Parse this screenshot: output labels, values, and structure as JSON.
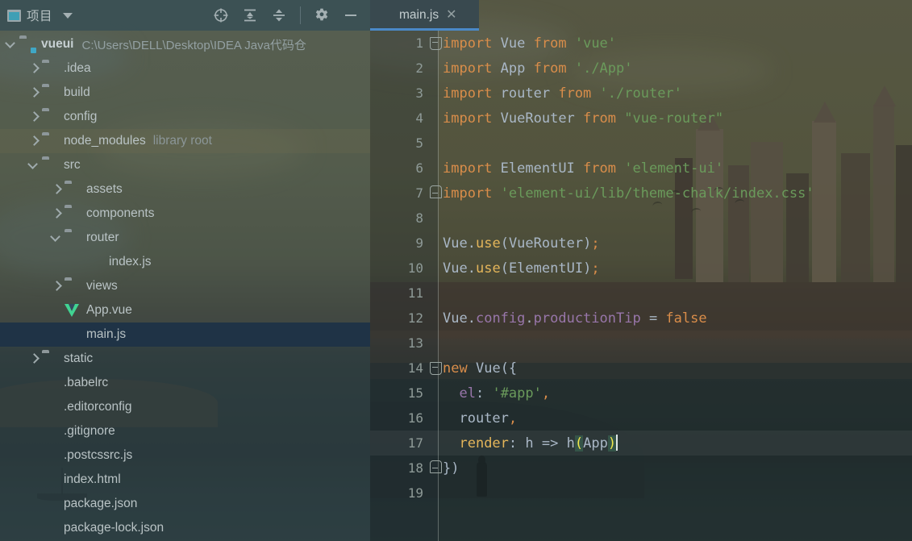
{
  "window": {
    "title": "IntelliJ IDEA Project View"
  },
  "sidebar": {
    "panel_title": "项目",
    "panel_icon": "project-window-icon",
    "dropdown_icon": "chevron-down-icon",
    "actions": [
      {
        "name": "select-opened-file-icon",
        "label": "Select Opened File"
      },
      {
        "name": "expand-all-icon",
        "label": "Expand All"
      },
      {
        "name": "collapse-all-icon",
        "label": "Collapse All"
      },
      {
        "name": "settings-gear-icon",
        "label": "Settings"
      },
      {
        "name": "hide-icon",
        "label": "Hide"
      }
    ],
    "tree": [
      {
        "name": "vueui",
        "hint": "",
        "path": "C:\\Users\\DELL\\Desktop\\IDEA Java代码仓",
        "icon": "folder-module",
        "indent": 0,
        "arrow": "down",
        "bold": true,
        "selected": false,
        "tint": false
      },
      {
        "name": ".idea",
        "hint": "",
        "path": "",
        "icon": "folder",
        "indent": 1,
        "arrow": "right",
        "bold": false,
        "selected": false,
        "tint": false
      },
      {
        "name": "build",
        "hint": "",
        "path": "",
        "icon": "folder",
        "indent": 1,
        "arrow": "right",
        "bold": false,
        "selected": false,
        "tint": false
      },
      {
        "name": "config",
        "hint": "",
        "path": "",
        "icon": "folder",
        "indent": 1,
        "arrow": "right",
        "bold": false,
        "selected": false,
        "tint": false
      },
      {
        "name": "node_modules",
        "hint": "library root",
        "path": "",
        "icon": "folder",
        "indent": 1,
        "arrow": "right",
        "bold": false,
        "selected": false,
        "tint": true
      },
      {
        "name": "src",
        "hint": "",
        "path": "",
        "icon": "folder",
        "indent": 1,
        "arrow": "down",
        "bold": false,
        "selected": false,
        "tint": false
      },
      {
        "name": "assets",
        "hint": "",
        "path": "",
        "icon": "folder",
        "indent": 2,
        "arrow": "right",
        "bold": false,
        "selected": false,
        "tint": false
      },
      {
        "name": "components",
        "hint": "",
        "path": "",
        "icon": "folder",
        "indent": 2,
        "arrow": "right",
        "bold": false,
        "selected": false,
        "tint": false
      },
      {
        "name": "router",
        "hint": "",
        "path": "",
        "icon": "folder",
        "indent": 2,
        "arrow": "down",
        "bold": false,
        "selected": false,
        "tint": false
      },
      {
        "name": "index.js",
        "hint": "",
        "path": "",
        "icon": "file-js",
        "indent": 3,
        "arrow": "none",
        "bold": false,
        "selected": false,
        "tint": false
      },
      {
        "name": "views",
        "hint": "",
        "path": "",
        "icon": "folder",
        "indent": 2,
        "arrow": "right",
        "bold": false,
        "selected": false,
        "tint": false
      },
      {
        "name": "App.vue",
        "hint": "",
        "path": "",
        "icon": "file-vue",
        "indent": 2,
        "arrow": "none",
        "bold": false,
        "selected": false,
        "tint": false
      },
      {
        "name": "main.js",
        "hint": "",
        "path": "",
        "icon": "file-js",
        "indent": 2,
        "arrow": "none",
        "bold": false,
        "selected": true,
        "tint": false
      },
      {
        "name": "static",
        "hint": "",
        "path": "",
        "icon": "folder",
        "indent": 1,
        "arrow": "right",
        "bold": false,
        "selected": false,
        "tint": false
      },
      {
        "name": ".babelrc",
        "hint": "",
        "path": "",
        "icon": "file-json",
        "indent": 1,
        "arrow": "none",
        "bold": false,
        "selected": false,
        "tint": false
      },
      {
        "name": ".editorconfig",
        "hint": "",
        "path": "",
        "icon": "file-cog",
        "indent": 1,
        "arrow": "none",
        "bold": false,
        "selected": false,
        "tint": false
      },
      {
        "name": ".gitignore",
        "hint": "",
        "path": "",
        "icon": "file-git",
        "indent": 1,
        "arrow": "none",
        "bold": false,
        "selected": false,
        "tint": false
      },
      {
        "name": ".postcssrc.js",
        "hint": "",
        "path": "",
        "icon": "file-js",
        "indent": 1,
        "arrow": "none",
        "bold": false,
        "selected": false,
        "tint": false
      },
      {
        "name": "index.html",
        "hint": "",
        "path": "",
        "icon": "file-html",
        "indent": 1,
        "arrow": "none",
        "bold": false,
        "selected": false,
        "tint": false
      },
      {
        "name": "package.json",
        "hint": "",
        "path": "",
        "icon": "file-json",
        "indent": 1,
        "arrow": "none",
        "bold": false,
        "selected": false,
        "tint": false
      },
      {
        "name": "package-lock.json",
        "hint": "",
        "path": "",
        "icon": "file-json",
        "indent": 1,
        "arrow": "none",
        "bold": false,
        "selected": false,
        "tint": false
      }
    ]
  },
  "editor": {
    "tab": {
      "label": "main.js",
      "icon": "file-js",
      "close_icon": "close-icon",
      "active": true
    },
    "accent_color": "#4a89c8",
    "current_line": 17,
    "lines": [
      {
        "n": "1",
        "fold": "minus",
        "tokens": [
          {
            "t": "import",
            "c": "kw"
          },
          {
            "t": " ",
            "c": "pun"
          },
          {
            "t": "Vue",
            "c": "id"
          },
          {
            "t": " ",
            "c": "pun"
          },
          {
            "t": "from",
            "c": "kw"
          },
          {
            "t": " ",
            "c": "pun"
          },
          {
            "t": "'vue'",
            "c": "str"
          }
        ]
      },
      {
        "n": "2",
        "fold": "",
        "tokens": [
          {
            "t": "import",
            "c": "kw"
          },
          {
            "t": " ",
            "c": "pun"
          },
          {
            "t": "App",
            "c": "id"
          },
          {
            "t": " ",
            "c": "pun"
          },
          {
            "t": "from",
            "c": "kw"
          },
          {
            "t": " ",
            "c": "pun"
          },
          {
            "t": "'./App'",
            "c": "str"
          }
        ]
      },
      {
        "n": "3",
        "fold": "",
        "tokens": [
          {
            "t": "import",
            "c": "kw"
          },
          {
            "t": " ",
            "c": "pun"
          },
          {
            "t": "router",
            "c": "id"
          },
          {
            "t": " ",
            "c": "pun"
          },
          {
            "t": "from",
            "c": "kw"
          },
          {
            "t": " ",
            "c": "pun"
          },
          {
            "t": "'./router'",
            "c": "str"
          }
        ]
      },
      {
        "n": "4",
        "fold": "",
        "tokens": [
          {
            "t": "import",
            "c": "kw"
          },
          {
            "t": " ",
            "c": "pun"
          },
          {
            "t": "VueRouter",
            "c": "id"
          },
          {
            "t": " ",
            "c": "pun"
          },
          {
            "t": "from",
            "c": "kw"
          },
          {
            "t": " ",
            "c": "pun"
          },
          {
            "t": "\"vue-router\"",
            "c": "str"
          }
        ]
      },
      {
        "n": "5",
        "fold": "",
        "tokens": []
      },
      {
        "n": "6",
        "fold": "",
        "tokens": [
          {
            "t": "import",
            "c": "kw"
          },
          {
            "t": " ",
            "c": "pun"
          },
          {
            "t": "ElementUI",
            "c": "id"
          },
          {
            "t": " ",
            "c": "pun"
          },
          {
            "t": "from",
            "c": "kw"
          },
          {
            "t": " ",
            "c": "pun"
          },
          {
            "t": "'element-ui'",
            "c": "str"
          }
        ]
      },
      {
        "n": "7",
        "fold": "end",
        "tokens": [
          {
            "t": "import",
            "c": "kw"
          },
          {
            "t": " ",
            "c": "pun"
          },
          {
            "t": "'element-ui/lib/theme-chalk/index.css'",
            "c": "str"
          }
        ]
      },
      {
        "n": "8",
        "fold": "",
        "tokens": []
      },
      {
        "n": "9",
        "fold": "",
        "tokens": [
          {
            "t": "Vue",
            "c": "id"
          },
          {
            "t": ".",
            "c": "pun"
          },
          {
            "t": "use",
            "c": "fn"
          },
          {
            "t": "(",
            "c": "pun"
          },
          {
            "t": "VueRouter",
            "c": "id"
          },
          {
            "t": ")",
            "c": "pun"
          },
          {
            "t": ";",
            "c": "num"
          }
        ]
      },
      {
        "n": "10",
        "fold": "",
        "tokens": [
          {
            "t": "Vue",
            "c": "id"
          },
          {
            "t": ".",
            "c": "pun"
          },
          {
            "t": "use",
            "c": "fn"
          },
          {
            "t": "(",
            "c": "pun"
          },
          {
            "t": "ElementUI",
            "c": "id"
          },
          {
            "t": ")",
            "c": "pun"
          },
          {
            "t": ";",
            "c": "num"
          }
        ]
      },
      {
        "n": "11",
        "fold": "",
        "tokens": []
      },
      {
        "n": "12",
        "fold": "",
        "tokens": [
          {
            "t": "Vue",
            "c": "id"
          },
          {
            "t": ".",
            "c": "pun"
          },
          {
            "t": "config",
            "c": "prop"
          },
          {
            "t": ".",
            "c": "pun"
          },
          {
            "t": "productionTip",
            "c": "prop"
          },
          {
            "t": " = ",
            "c": "pun"
          },
          {
            "t": "false",
            "c": "kw"
          }
        ]
      },
      {
        "n": "13",
        "fold": "",
        "tokens": []
      },
      {
        "n": "14",
        "fold": "minus",
        "tokens": [
          {
            "t": "new",
            "c": "kw"
          },
          {
            "t": " ",
            "c": "pun"
          },
          {
            "t": "Vue",
            "c": "id"
          },
          {
            "t": "({",
            "c": "pun"
          }
        ]
      },
      {
        "n": "15",
        "fold": "",
        "tokens": [
          {
            "t": "  ",
            "c": "pun"
          },
          {
            "t": "el",
            "c": "prop"
          },
          {
            "t": ": ",
            "c": "pun"
          },
          {
            "t": "'#app'",
            "c": "str"
          },
          {
            "t": ",",
            "c": "num"
          }
        ]
      },
      {
        "n": "16",
        "fold": "",
        "tokens": [
          {
            "t": "  ",
            "c": "pun"
          },
          {
            "t": "router",
            "c": "id"
          },
          {
            "t": ",",
            "c": "num"
          }
        ]
      },
      {
        "n": "17",
        "fold": "",
        "tokens": [
          {
            "t": "  ",
            "c": "pun"
          },
          {
            "t": "render",
            "c": "fn"
          },
          {
            "t": ": ",
            "c": "pun"
          },
          {
            "t": "h",
            "c": "id"
          },
          {
            "t": " => ",
            "c": "pun"
          },
          {
            "t": "h",
            "c": "id"
          },
          {
            "t": "(",
            "c": "brhl"
          },
          {
            "t": "App",
            "c": "id"
          },
          {
            "t": ")",
            "c": "brhl"
          }
        ],
        "cursor": true
      },
      {
        "n": "18",
        "fold": "end",
        "tokens": [
          {
            "t": "})",
            "c": "pun"
          }
        ]
      },
      {
        "n": "19",
        "fold": "",
        "tokens": []
      }
    ]
  }
}
